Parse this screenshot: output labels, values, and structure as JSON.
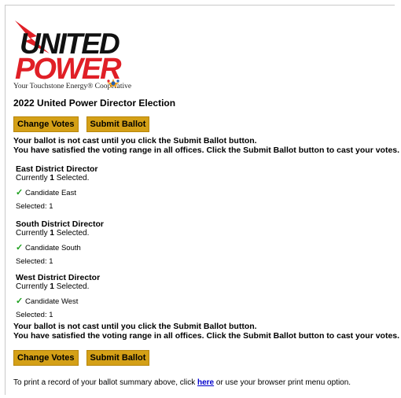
{
  "logo": {
    "line1": "UNITED",
    "line2": "POWER",
    "tagline": "Your Touchstone Energy® Cooperative"
  },
  "election": {
    "title": "2022 United Power Director Election"
  },
  "buttons": {
    "change_votes": "Change Votes",
    "submit_ballot": "Submit Ballot"
  },
  "notice": {
    "line1": "Your ballot is not cast until you click the Submit Ballot button.",
    "line2": "You have satisfied the voting range in all offices. Click the Submit Ballot button to cast your votes."
  },
  "offices": [
    {
      "name": "East District Director",
      "currently_prefix": "Currently ",
      "currently_count": "1",
      "currently_suffix": " Selected.",
      "candidate": "Candidate East",
      "selected": "Selected: 1"
    },
    {
      "name": "South District Director",
      "currently_prefix": "Currently ",
      "currently_count": "1",
      "currently_suffix": " Selected.",
      "candidate": "Candidate South",
      "selected": "Selected: 1"
    },
    {
      "name": "West District Director",
      "currently_prefix": "Currently ",
      "currently_count": "1",
      "currently_suffix": " Selected.",
      "candidate": "Candidate West",
      "selected": "Selected: 1"
    }
  ],
  "print_note": {
    "prefix": "To print a record of your ballot summary above, click ",
    "link": "here",
    "suffix": " or use your browser print menu option."
  },
  "colors": {
    "button": "#d4a017",
    "brand_red": "#e01f26",
    "check": "#1a9e1a",
    "link": "#0000cc"
  }
}
